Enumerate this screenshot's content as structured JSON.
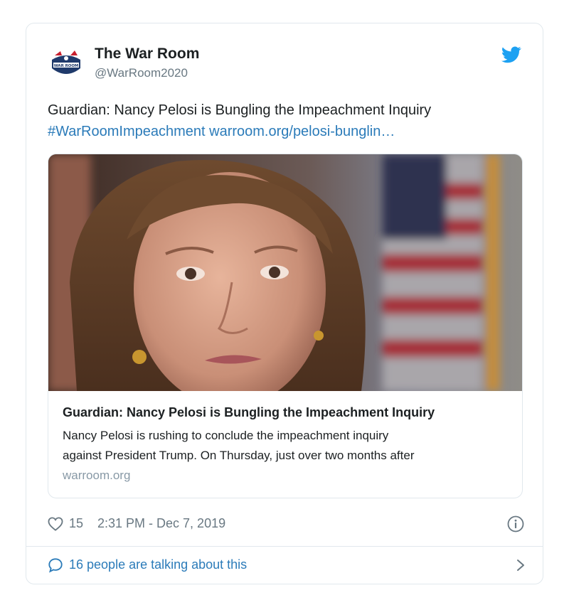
{
  "author": {
    "display_name": "The War Room",
    "handle": "@WarRoom2020",
    "avatar_icon": "war-room-logo",
    "avatar_text": "WAR ROOM"
  },
  "tweet": {
    "text_line1": "Guardian: Nancy Pelosi is Bungling the Impeachment Inquiry",
    "hashtag": "#WarRoomImpeachment",
    "url": "warroom.org/pelosi-bunglin…"
  },
  "card": {
    "image_icon": "photo-portrait",
    "title": "Guardian: Nancy Pelosi is Bungling the Impeachment Inquiry",
    "desc_line1": "Nancy Pelosi is rushing to conclude the impeachment inquiry",
    "desc_line2": "against President Trump. On Thursday, just over two months after",
    "domain": "warroom.org"
  },
  "meta": {
    "like_count": "15",
    "timestamp": "2:31 PM - Dec 7, 2019",
    "info_icon": "info-icon"
  },
  "footer": {
    "talking_text": "16 people are talking about this",
    "chevron_icon": "chevron-right-icon"
  },
  "colors": {
    "link": "#2b7bb9",
    "muted": "#697882",
    "border": "#e1e8ed",
    "twitter_blue": "#1da1f2"
  }
}
